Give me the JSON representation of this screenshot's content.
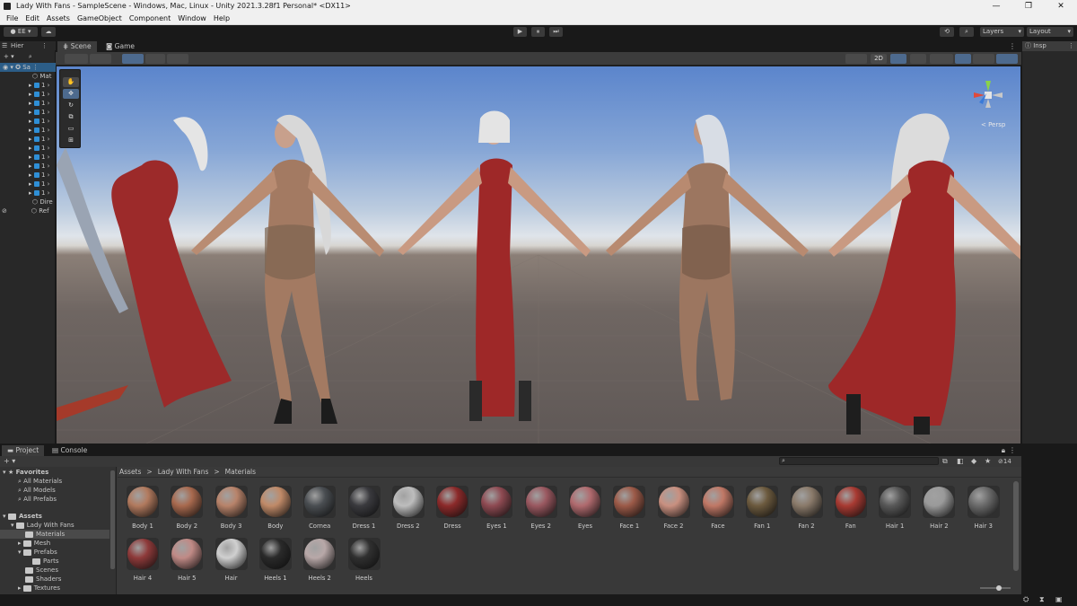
{
  "window": {
    "title": "Lady With Fans - SampleScene - Windows, Mac, Linux - Unity 2021.3.28f1 Personal* <DX11>",
    "controls": [
      "—",
      "❐",
      "✕"
    ]
  },
  "menu": [
    "File",
    "Edit",
    "Assets",
    "GameObject",
    "Component",
    "Window",
    "Help"
  ],
  "toolbar": {
    "account": "EE",
    "play": "▶",
    "pause": "⏸",
    "step": "⏭",
    "layers": "Layers",
    "layout": "Layout"
  },
  "hierarchy": {
    "tab": "Hier",
    "scene": "Sa",
    "items": [
      "Mat",
      "1",
      "1",
      "1",
      "1",
      "1",
      "1",
      "1",
      "1",
      "1",
      "1",
      "1",
      "1",
      "1",
      "Dire",
      "Ref"
    ]
  },
  "scene_tabs": [
    "Scene",
    "Game"
  ],
  "scene_tools": {
    "mode_2d": "2D",
    "persp": "< Persp"
  },
  "inspector": {
    "tab": "Insp"
  },
  "project": {
    "tabs": [
      "Project",
      "Console"
    ],
    "count": "14",
    "favorites": {
      "label": "Favorites",
      "items": [
        "All Materials",
        "All Models",
        "All Prefabs"
      ]
    },
    "assets": {
      "label": "Assets",
      "items": [
        "Lady With Fans",
        "Materials",
        "Mesh",
        "Prefabs",
        "Parts",
        "Scenes",
        "Shaders",
        "Textures"
      ]
    },
    "breadcrumb": [
      "Assets",
      ">",
      "Lady With Fans",
      ">",
      "Materials"
    ],
    "materials": [
      {
        "name": "Body 1",
        "color": "#b27a5e"
      },
      {
        "name": "Body 2",
        "color": "#a8694e"
      },
      {
        "name": "Body 3",
        "color": "#b8836a"
      },
      {
        "name": "Body",
        "color": "#c08a68"
      },
      {
        "name": "Cornea",
        "color": "#4a4e52"
      },
      {
        "name": "Dress 1",
        "color": "#3a3a3e"
      },
      {
        "name": "Dress 2",
        "color": "#bdbdbd"
      },
      {
        "name": "Dress",
        "color": "#8c2a2a"
      },
      {
        "name": "Eyes 1",
        "color": "#8e4a52"
      },
      {
        "name": "Eyes 2",
        "color": "#9a5860"
      },
      {
        "name": "Eyes",
        "color": "#b06a6e"
      },
      {
        "name": "Face 1",
        "color": "#9c5a48"
      },
      {
        "name": "Face 2",
        "color": "#c99080"
      },
      {
        "name": "Face",
        "color": "#c07866"
      },
      {
        "name": "Fan 1",
        "color": "#6c5a3e"
      },
      {
        "name": "Fan 2",
        "color": "#8a7a6a"
      },
      {
        "name": "Fan",
        "color": "#a83a32"
      },
      {
        "name": "Hair 1",
        "color": "#585858"
      },
      {
        "name": "Hair 2",
        "color": "#9a9a9a"
      },
      {
        "name": "Hair 3",
        "color": "#6a6a6a"
      },
      {
        "name": "Hair 4",
        "color": "#8e3a3a"
      },
      {
        "name": "Hair 5",
        "color": "#c08a86"
      },
      {
        "name": "Hair",
        "color": "#d0d0d0"
      },
      {
        "name": "Heels 1",
        "color": "#2a2a2a"
      },
      {
        "name": "Heels 2",
        "color": "#b8a8a8"
      },
      {
        "name": "Heels",
        "color": "#303030"
      }
    ]
  }
}
